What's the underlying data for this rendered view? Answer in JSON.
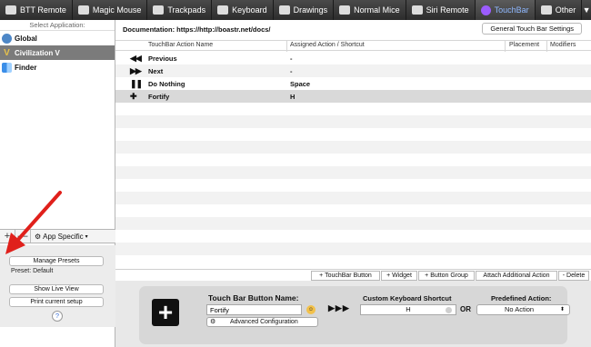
{
  "toolbar": {
    "tabs": [
      {
        "label": "BTT Remote",
        "icon": "remote-icon",
        "name": "tab-btt-remote"
      },
      {
        "label": "Magic Mouse",
        "icon": "mouse-icon",
        "name": "tab-magic-mouse"
      },
      {
        "label": "Trackpads",
        "icon": "trackpad-icon",
        "name": "tab-trackpads"
      },
      {
        "label": "Keyboard",
        "icon": "keyboard-icon",
        "name": "tab-keyboard"
      },
      {
        "label": "Drawings",
        "icon": "drawing-icon",
        "name": "tab-drawings"
      },
      {
        "label": "Normal Mice",
        "icon": "mouse-icon",
        "name": "tab-normal-mice"
      },
      {
        "label": "Siri Remote",
        "icon": "siri-remote-icon",
        "name": "tab-siri-remote"
      },
      {
        "label": "TouchBar",
        "icon": "touchbar-icon",
        "name": "tab-touchbar",
        "active": true
      },
      {
        "label": "Other",
        "icon": "dots-icon",
        "name": "tab-other"
      }
    ],
    "expand_glyph": "▼"
  },
  "sidebar": {
    "title": "Select Application:",
    "apps": [
      {
        "label": "Global",
        "icon": "globe-icon"
      },
      {
        "label": "Civilization V",
        "icon": "civilization-icon",
        "selected": true
      },
      {
        "label": "Finder",
        "icon": "finder-icon"
      }
    ],
    "add_glyph": "+",
    "remove_glyph": "—",
    "gear_glyph": "⚙",
    "app_specific_label": "App Specific",
    "app_specific_chevron": "▾",
    "manage_presets": "Manage Presets",
    "preset_label": "Preset: Default",
    "show_live_view": "Show Live View",
    "print_setup": "Print current setup",
    "help": "?"
  },
  "main": {
    "documentation": "Documentation: https://http://boastr.net/docs/",
    "general_settings": "General Touch Bar Settings",
    "columns": {
      "action_name": "TouchBar Action Name",
      "assigned": "Assigned Action / Shortcut",
      "placement": "Placement",
      "modifiers": "Modifiers"
    },
    "rows": [
      {
        "icon": "rewind-icon",
        "glyph": "◀◀",
        "name": "Previous",
        "action": "-"
      },
      {
        "icon": "fast-forward-icon",
        "glyph": "▶▶",
        "name": "Next",
        "action": "-"
      },
      {
        "icon": "pause-icon",
        "glyph": "❚❚",
        "name": "Do Nothing",
        "action": "Space"
      },
      {
        "icon": "plus-icon",
        "glyph": "✚",
        "name": "Fortify",
        "action": "H",
        "selected": true
      }
    ],
    "add_buttons": {
      "touchbar_button": "+ TouchBar Button",
      "widget": "+ Widget",
      "button_group": "+ Button Group",
      "attach_action": "Attach Additional Action",
      "delete": "- Delete"
    }
  },
  "detail": {
    "icon_glyph": "+",
    "name_label": "Touch Bar Button Name:",
    "name_value": "Fortify",
    "emoji_glyph": "☺",
    "gear_glyph": "⚙",
    "advanced_config": "Advanced Configuration",
    "arrows": "▶▶▶",
    "shortcut_label": "Custom Keyboard Shortcut",
    "shortcut_value": "H",
    "or_label": "OR",
    "predefined_label": "Predefined Action:",
    "predefined_value": "No Action",
    "predefined_chevron": "⬍"
  },
  "colors": {
    "toolbar_bg": "#3a3a3a",
    "active_tab_text": "#8fb8ff",
    "selected_row": "#d9d9d9",
    "annotation_arrow": "#e0201b"
  }
}
